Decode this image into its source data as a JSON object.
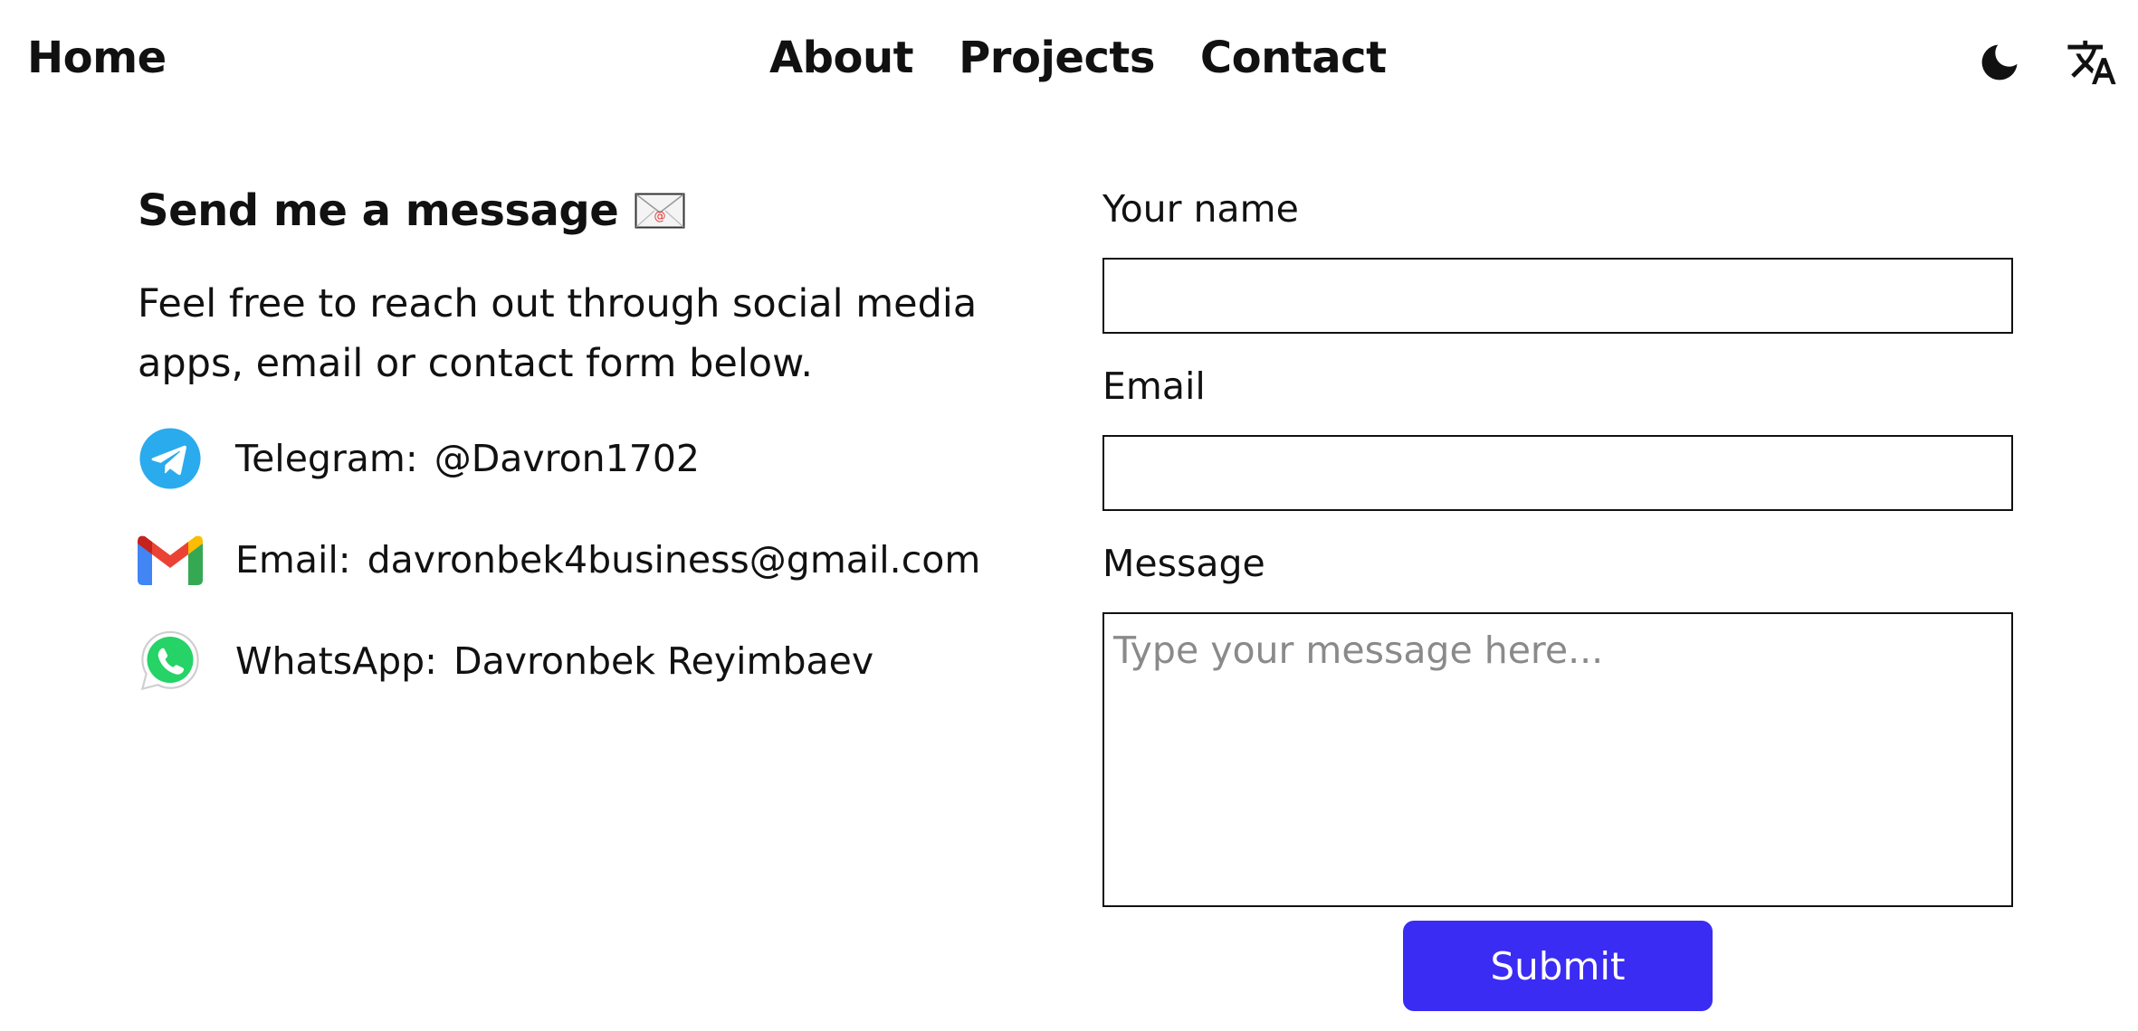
{
  "nav": {
    "home_label": "Home",
    "links": [
      {
        "label": "About"
      },
      {
        "label": "Projects"
      },
      {
        "label": "Contact"
      }
    ],
    "theme_toggle_icon": "moon-icon",
    "language_toggle_icon": "translate-icon"
  },
  "contact_section": {
    "heading": "Send me a message",
    "heading_icon": "envelope-icon",
    "intro": "Feel free to reach out through social media apps, email or contact form below.",
    "items": [
      {
        "icon": "telegram-icon",
        "label": "Telegram:",
        "value": "@Davron1702"
      },
      {
        "icon": "gmail-icon",
        "label": "Email:",
        "value": "davronbek4business@gmail.com"
      },
      {
        "icon": "whatsapp-icon",
        "label": "WhatsApp:",
        "value": "Davronbek Reyimbaev"
      }
    ]
  },
  "form": {
    "name_label": "Your name",
    "name_value": "",
    "email_label": "Email",
    "email_value": "",
    "message_label": "Message",
    "message_placeholder": "Type your message here...",
    "message_value": "",
    "submit_label": "Submit"
  },
  "colors": {
    "accent": "#3a2cf3",
    "text": "#111111",
    "placeholder": "#8a8a8a",
    "telegram": "#2aabee",
    "whatsapp": "#25d366"
  }
}
